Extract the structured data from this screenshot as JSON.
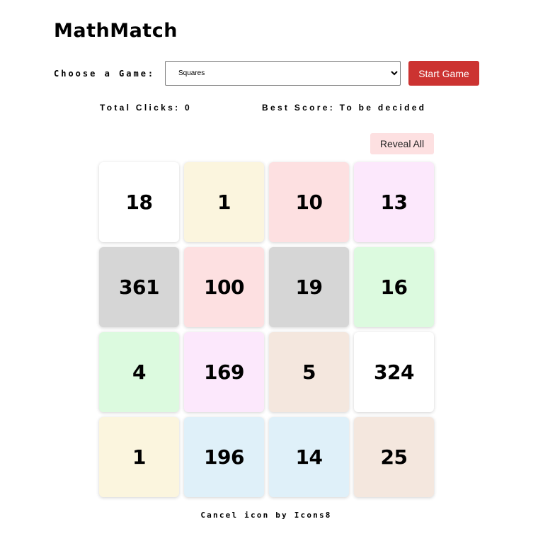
{
  "app": {
    "title": "MathMatch"
  },
  "controls": {
    "choose_label": "Choose a Game:",
    "selected_game": "Squares",
    "start_label": "Start Game",
    "start_color": "#cc3331"
  },
  "stats": {
    "clicks_text": "Total Clicks: 0",
    "best_text": "Best Score: To be decided"
  },
  "reveal": {
    "label": "Reveal All",
    "color": "#fde0e1"
  },
  "cards": [
    {
      "value": "18",
      "color": "#ffffff"
    },
    {
      "value": "1",
      "color": "#fbf5de"
    },
    {
      "value": "10",
      "color": "#fde0e1"
    },
    {
      "value": "13",
      "color": "#fce8fc"
    },
    {
      "value": "361",
      "color": "#d6d6d6"
    },
    {
      "value": "100",
      "color": "#fde0e1"
    },
    {
      "value": "19",
      "color": "#d6d6d6"
    },
    {
      "value": "16",
      "color": "#dcfadf"
    },
    {
      "value": "4",
      "color": "#dcfadf"
    },
    {
      "value": "169",
      "color": "#fce8fc"
    },
    {
      "value": "5",
      "color": "#f4e7de"
    },
    {
      "value": "324",
      "color": "#ffffff"
    },
    {
      "value": "1",
      "color": "#fbf5de"
    },
    {
      "value": "196",
      "color": "#dff0f9"
    },
    {
      "value": "14",
      "color": "#dff0f9"
    },
    {
      "value": "25",
      "color": "#f4e7de"
    }
  ],
  "footer": {
    "credit": "Cancel icon by Icons8"
  }
}
